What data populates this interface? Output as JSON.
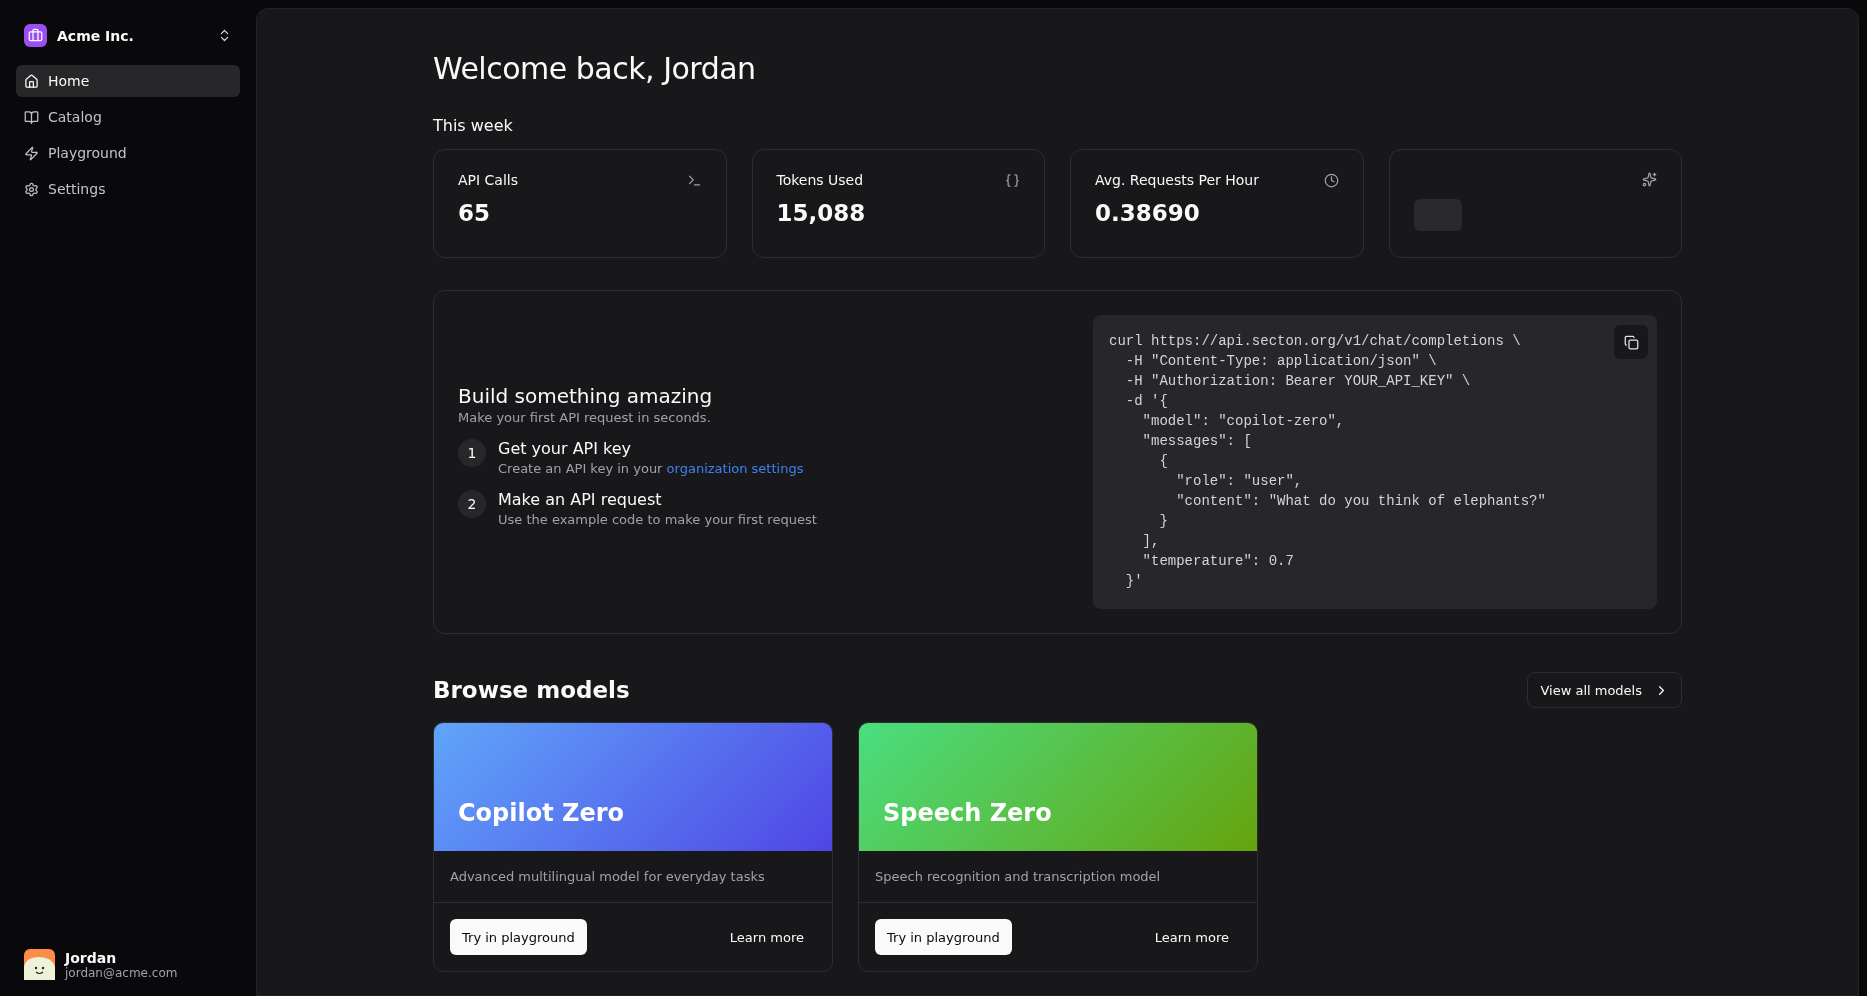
{
  "sidebar": {
    "org": {
      "name": "Acme Inc."
    },
    "items": [
      {
        "label": "Home",
        "selected": true
      },
      {
        "label": "Catalog",
        "selected": false
      },
      {
        "label": "Playground",
        "selected": false
      },
      {
        "label": "Settings",
        "selected": false
      }
    ],
    "user": {
      "name": "Jordan",
      "email": "jordan@acme.com"
    }
  },
  "main": {
    "title": "Welcome back, Jordan",
    "section": "This week",
    "stats": [
      {
        "kind": "metric",
        "label": "API Calls",
        "value": "65"
      },
      {
        "kind": "metric",
        "label": "Tokens Used",
        "value": "15,088"
      },
      {
        "kind": "metric",
        "label": "Avg. Requests Per Hour",
        "value": "0.38690"
      },
      {
        "kind": "loading"
      }
    ],
    "quickstart": {
      "title": "Build something amazing",
      "subtitle": "Make your first API request in seconds.",
      "steps": [
        {
          "number": "1",
          "title": "Get your API key",
          "text": "Create an API key in your",
          "link": "organization settings"
        },
        {
          "number": "2",
          "title": "Make an API request",
          "text": "Use the example code to make your first request"
        }
      ],
      "code": "curl https://api.secton.org/v1/chat/completions \\\n  -H \"Content-Type: application/json\" \\\n  -H \"Authorization: Bearer YOUR_API_KEY\" \\\n  -d '{\n    \"model\": \"copilot-zero\",\n    \"messages\": [\n      {\n        \"role\": \"user\",\n        \"content\": \"What do you think of elephants?\"\n      }\n    ],\n    \"temperature\": 0.7\n  }'"
    },
    "models": {
      "title": "Browse models",
      "view_all": "View all models",
      "items": [
        {
          "kind": "indigo",
          "name": "Copilot Zero",
          "description": "Advanced multilingual model for everyday tasks",
          "primary": "Try in playground",
          "secondary": "Learn more"
        },
        {
          "kind": "lime",
          "name": "Speech Zero",
          "description": "Speech recognition and transcription model",
          "primary": "Try in playground",
          "secondary": "Learn more"
        }
      ]
    }
  }
}
